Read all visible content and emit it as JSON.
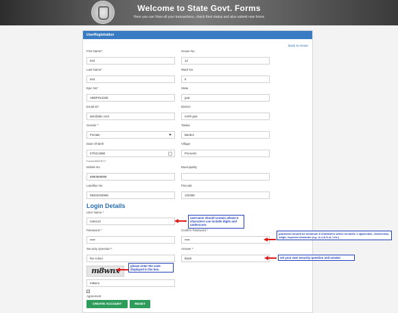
{
  "banner": {
    "title": "Welcome to State Govt. Forms",
    "subtitle": "Here you can View all your transactions, check their status and also submit new forms"
  },
  "panel": {
    "header": "UserRegistration",
    "back_link": "Back to Home"
  },
  "fields": {
    "first_name": {
      "label": "First Name*",
      "value": "test"
    },
    "house_no": {
      "label": "House No",
      "value": "12"
    },
    "last_name": {
      "label": "Last Name*",
      "value": "test"
    },
    "ward_no": {
      "label": "Ward No",
      "value": "6"
    },
    "epic_no": {
      "label": "Epic No*",
      "value": "ABDP012345"
    },
    "state": {
      "label": "State",
      "value": "goa"
    },
    "email": {
      "label": "Email ID*",
      "value": "abc@abc.com"
    },
    "district": {
      "label": "District",
      "value": "north goa"
    },
    "gender": {
      "label": "Gender *",
      "value": "Female"
    },
    "taluka": {
      "label": "Taluka",
      "value": "Bardez"
    },
    "dob": {
      "label": "Date Of Birth",
      "value": "07/01/1988"
    },
    "village": {
      "label": "Village",
      "value": "Porvorim"
    },
    "mobile": {
      "label": "Mobile No",
      "value": "9890989898"
    },
    "municipality": {
      "label": "Municipality",
      "value": ""
    },
    "landline": {
      "label": "Landline No",
      "value": "08322234565"
    },
    "pincode": {
      "label": "Pincode",
      "value": "123456"
    }
  },
  "dob_hint": "Format MM/DD/YY",
  "login": {
    "section_title": "Login Details",
    "user_name": {
      "label": "User Name *",
      "value": "name12"
    },
    "password": {
      "label": "Password *",
      "value": "•••••"
    },
    "confirm_password": {
      "label": "Confirm Password *",
      "value": "•••••"
    },
    "security_question": {
      "label": "Security Question *",
      "value": "fav colour"
    },
    "answer": {
      "label": "Answer *",
      "value": "black"
    },
    "captcha_text": "m8wnx",
    "captcha_input": "m8wnx",
    "agreement_label": "Agreement"
  },
  "buttons": {
    "create": "CREATE ACCOUNT",
    "reset": "RESET"
  },
  "annotations": {
    "username_note": "username should contain atleast 5 characters can include digits and underscore.",
    "password_note": "password should be minimum 8 characters which includes 1 uppercase, 1lowercase, 1digit, 1special character (eg. @,#,$,%,&,*,etc.)",
    "security_note": "set your own security question and answer.",
    "captcha_note": "please enter the code displayed in the box."
  },
  "colors": {
    "header_blue": "#3a7cc4",
    "button_green": "#2e9d5c",
    "annotation_blue": "#1f3fbf",
    "arrow_red": "#e01818"
  }
}
